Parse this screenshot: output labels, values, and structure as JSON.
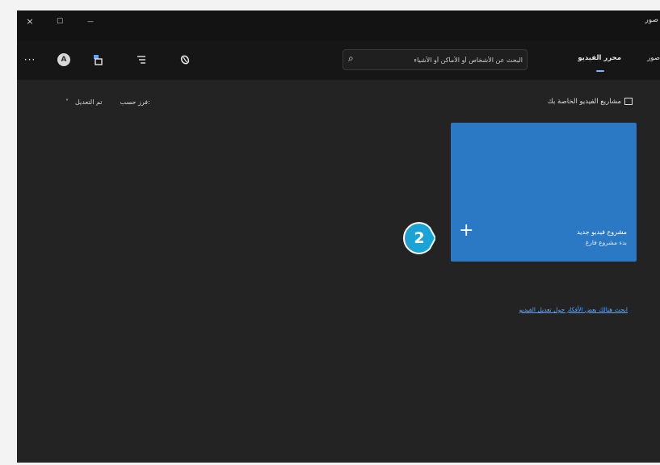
{
  "window": {
    "title": "صور",
    "controls": {
      "close": "×",
      "maximize": "☐",
      "minimize": "—"
    }
  },
  "toolbar": {
    "more": "···",
    "avatar_letter": "A",
    "icons": [
      "more-icon",
      "avatar",
      "import-icon",
      "filter-icon",
      "edit-icon"
    ],
    "search_placeholder": "البحث عن الأشخاص أو الأماكن أو الأشياء",
    "tabs": [
      {
        "label": "محرر الفيديو",
        "active": true
      },
      {
        "label": "صور",
        "active": false
      }
    ]
  },
  "main": {
    "sort": {
      "value": "تم التعديل",
      "prefix": "فرز حسب:",
      "chevron": "˅"
    },
    "section_title": "مشاريع الفيديو الخاصة بك",
    "new_project_card": {
      "plus": "+",
      "title": "مشروع فيديو جديد",
      "subtitle": "بدء مشروع فارغ"
    },
    "help_link": "ابحث هنالك بعض الأفكار حول تعديل الفيديو"
  },
  "callout": {
    "number": "2",
    "color": "#1ba3d6"
  },
  "colors": {
    "window_bg": "#232323",
    "titlebar_bg": "#131313",
    "card_bg": "#2b78c5",
    "accent": "#7ab5ff",
    "link": "#5aa7ff"
  }
}
